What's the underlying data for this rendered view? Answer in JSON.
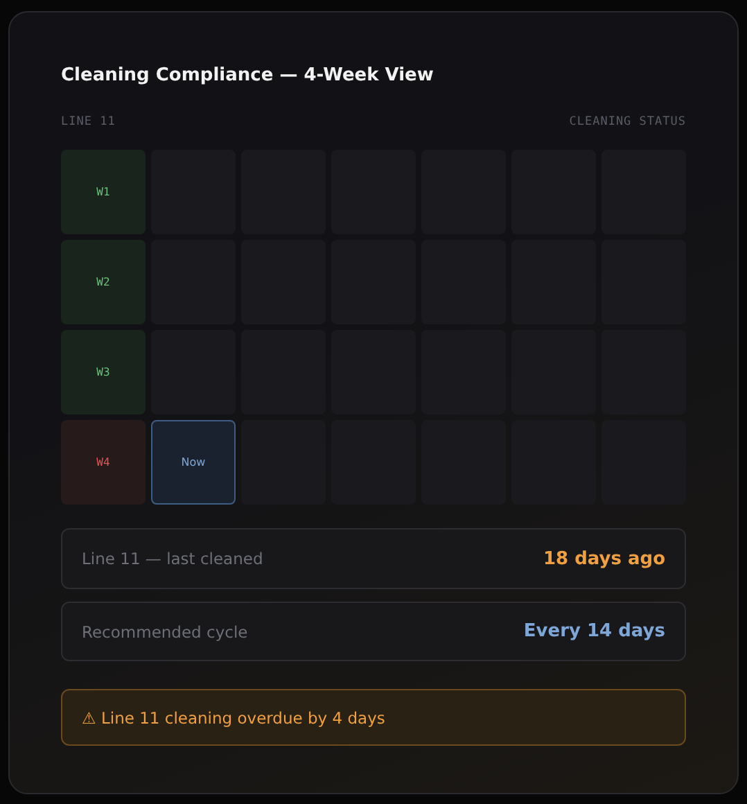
{
  "title": "Cleaning Compliance — 4-Week View",
  "header": {
    "left": "LINE 11",
    "right": "CLEANING STATUS"
  },
  "grid": [
    [
      {
        "kind": "ok",
        "label": "W1"
      },
      {
        "kind": "empty"
      },
      {
        "kind": "empty"
      },
      {
        "kind": "empty"
      },
      {
        "kind": "empty"
      },
      {
        "kind": "empty"
      },
      {
        "kind": "empty"
      }
    ],
    [
      {
        "kind": "ok",
        "label": "W2"
      },
      {
        "kind": "empty"
      },
      {
        "kind": "empty"
      },
      {
        "kind": "empty"
      },
      {
        "kind": "empty"
      },
      {
        "kind": "empty"
      },
      {
        "kind": "empty"
      }
    ],
    [
      {
        "kind": "ok",
        "label": "W3"
      },
      {
        "kind": "empty"
      },
      {
        "kind": "empty"
      },
      {
        "kind": "empty"
      },
      {
        "kind": "empty"
      },
      {
        "kind": "empty"
      },
      {
        "kind": "empty"
      }
    ],
    [
      {
        "kind": "overdue",
        "label": "W4"
      },
      {
        "kind": "now",
        "label": "Now"
      },
      {
        "kind": "empty"
      },
      {
        "kind": "empty"
      },
      {
        "kind": "empty"
      },
      {
        "kind": "empty"
      },
      {
        "kind": "empty"
      }
    ]
  ],
  "stats": [
    {
      "label": "Line 11 — last cleaned",
      "value": "18 days ago",
      "color": "#f0a040"
    },
    {
      "label": "Recommended cycle",
      "value": "Every 14 days",
      "color": "#7ea6d6"
    }
  ],
  "alert": {
    "text": "⚠ Line 11 cleaning overdue by 4 days"
  }
}
